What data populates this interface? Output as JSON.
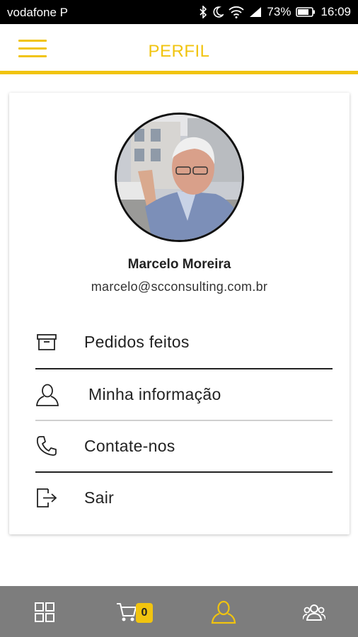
{
  "status_bar": {
    "carrier": "vodafone P",
    "battery": "73%",
    "time": "16:09"
  },
  "header": {
    "title": "PERFIL",
    "accent_color": "#f1c40f"
  },
  "profile": {
    "name": "Marcelo Moreira",
    "email": "marcelo@scconsulting.com.br"
  },
  "menu": [
    {
      "label": "Pedidos feitos",
      "icon": "archive-box-icon"
    },
    {
      "label": "Minha informação",
      "icon": "user-icon"
    },
    {
      "label": "Contate-nos",
      "icon": "phone-icon"
    },
    {
      "label": "Sair",
      "icon": "logout-icon"
    }
  ],
  "bottom_nav": {
    "items": [
      {
        "icon": "grid-icon"
      },
      {
        "icon": "cart-icon"
      },
      {
        "icon": "user-icon",
        "active": true
      },
      {
        "icon": "group-icon"
      }
    ],
    "cart_count": "0",
    "background": "#7d7d7d"
  }
}
